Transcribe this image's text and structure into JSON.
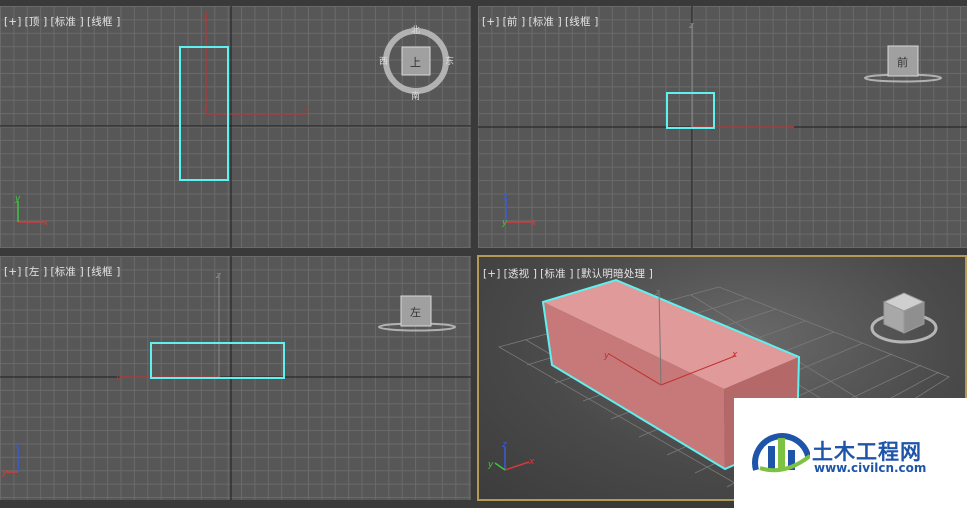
{
  "viewports": {
    "top": {
      "plus": "[+]",
      "view": "[顶 ]",
      "shading": "[标准 ]",
      "mode": "[线框 ]",
      "viewcube_label": "上",
      "compass": {
        "north": "北",
        "south": "南",
        "east": "东",
        "west": "西"
      }
    },
    "front": {
      "plus": "[+]",
      "view": "[前 ]",
      "shading": "[标准 ]",
      "mode": "[线框 ]",
      "viewcube_label": "前"
    },
    "left": {
      "plus": "[+]",
      "view": "[左 ]",
      "shading": "[标准 ]",
      "mode": "[线框 ]",
      "viewcube_label": "左"
    },
    "perspective": {
      "plus": "[+]",
      "view": "[透视 ]",
      "shading": "[标准 ]",
      "mode": "[默认明暗处理 ]"
    }
  },
  "axes": {
    "x": "x",
    "y": "y",
    "z": "z"
  },
  "colors": {
    "viewport_bg": "#575757",
    "selection": "#5ff0f0",
    "box_fill": "#d98a8a",
    "axis_x": "#d23c3c",
    "axis_y": "#3cc83c",
    "axis_z": "#3c5ad2",
    "active_border": "#b39a55"
  },
  "watermark": {
    "name": "土木工程网",
    "url": "www.civilcn.com"
  }
}
